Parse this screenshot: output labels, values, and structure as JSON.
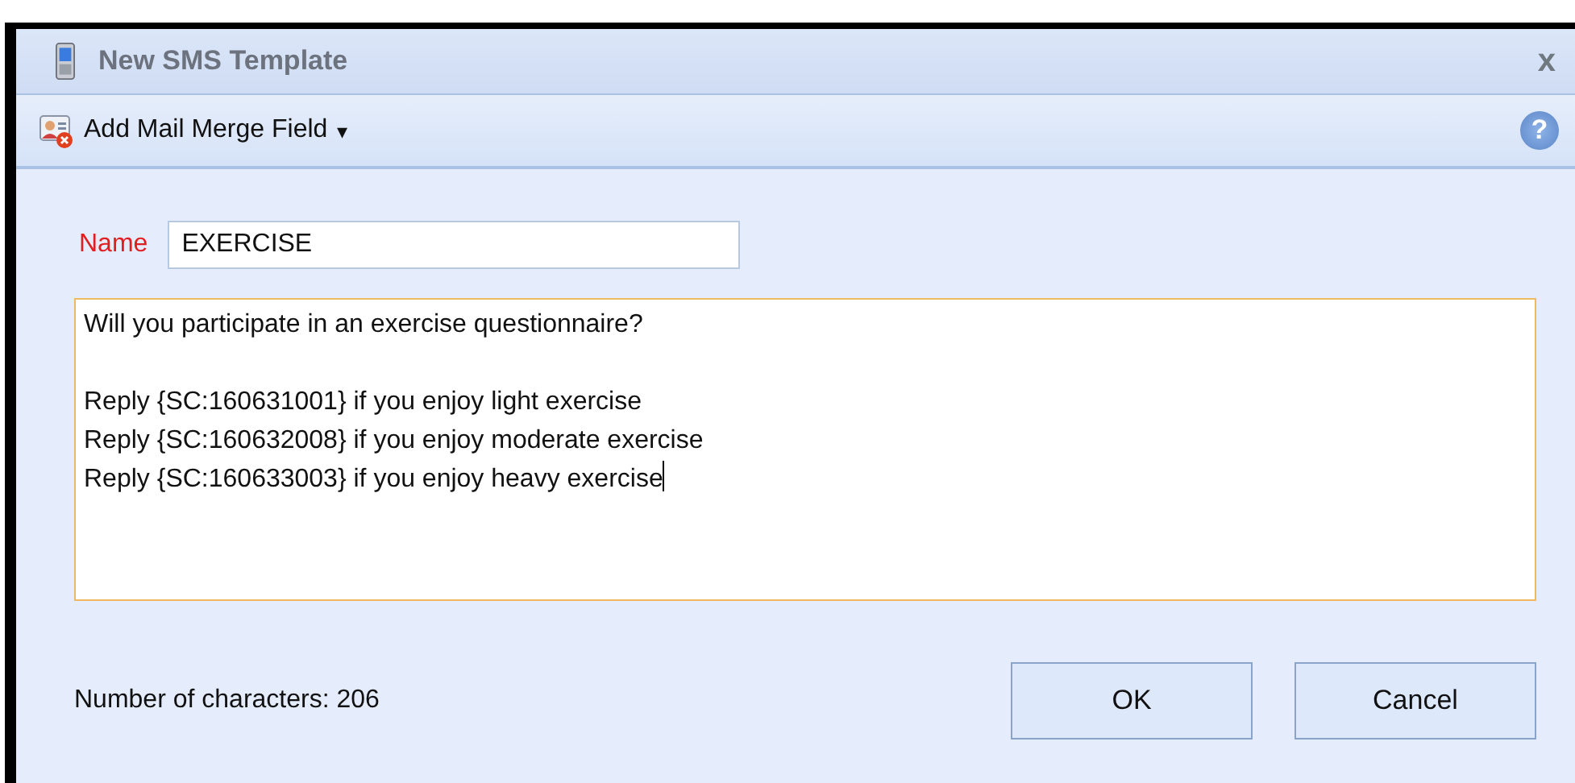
{
  "window": {
    "title": "New SMS Template",
    "close": "x"
  },
  "toolbar": {
    "menu_label": "Add Mail Merge Field",
    "menu_arrow": "▾",
    "help": "?"
  },
  "name_field": {
    "label": "Name",
    "value": "EXERCISE"
  },
  "message": {
    "value": "Will you participate in an exercise questionnaire?\n\nReply {SC:160631001} if you enjoy light exercise\nReply {SC:160632008} if you enjoy moderate exercise\nReply {SC:160633003} if you enjoy heavy exercise"
  },
  "character_count": "Number of characters: 206",
  "buttons": [
    {
      "label": "OK"
    },
    {
      "label": "Cancel"
    }
  ]
}
